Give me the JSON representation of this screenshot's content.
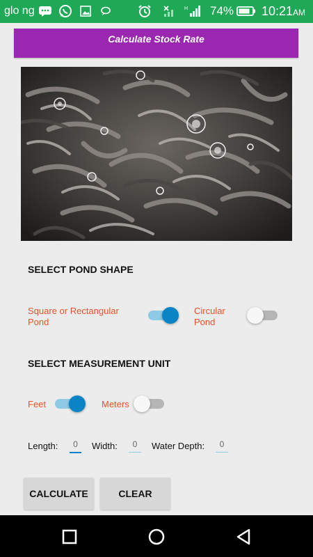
{
  "status_bar": {
    "carrier": "glo ng",
    "battery_percent": "74%",
    "time": "10:21",
    "time_suffix": "AM",
    "color": "#1fa855",
    "icons": [
      "sms-icon",
      "whatsapp-icon",
      "gallery-icon",
      "chat-icon",
      "alarm-icon",
      "wifi-off-icon",
      "signal-icon",
      "battery-icon"
    ]
  },
  "header": {
    "title": "Calculate Stock Rate",
    "color": "#9b27b0"
  },
  "pond_shape": {
    "title": "SELECT POND SHAPE",
    "options": [
      {
        "label_line1": "Square or Rectangular",
        "label_line2": "Pond",
        "checked": true
      },
      {
        "label_line1": "Circular",
        "label_line2": "Pond",
        "checked": false
      }
    ]
  },
  "measurement_unit": {
    "title": "SELECT MEASUREMENT UNIT",
    "options": [
      {
        "label": "Feet",
        "checked": true
      },
      {
        "label": "Meters",
        "checked": false
      }
    ]
  },
  "fields": {
    "length": {
      "label": "Length:",
      "value": "0"
    },
    "width": {
      "label": "Width:",
      "value": "0"
    },
    "water_depth": {
      "label": "Water Depth:",
      "value": "0"
    }
  },
  "buttons": {
    "calculate": "CALCULATE",
    "clear": "CLEAR"
  },
  "colors": {
    "accent": "#0a84c6",
    "option_label": "#e8522a"
  },
  "nav": [
    "recents-icon",
    "home-icon",
    "back-icon"
  ]
}
